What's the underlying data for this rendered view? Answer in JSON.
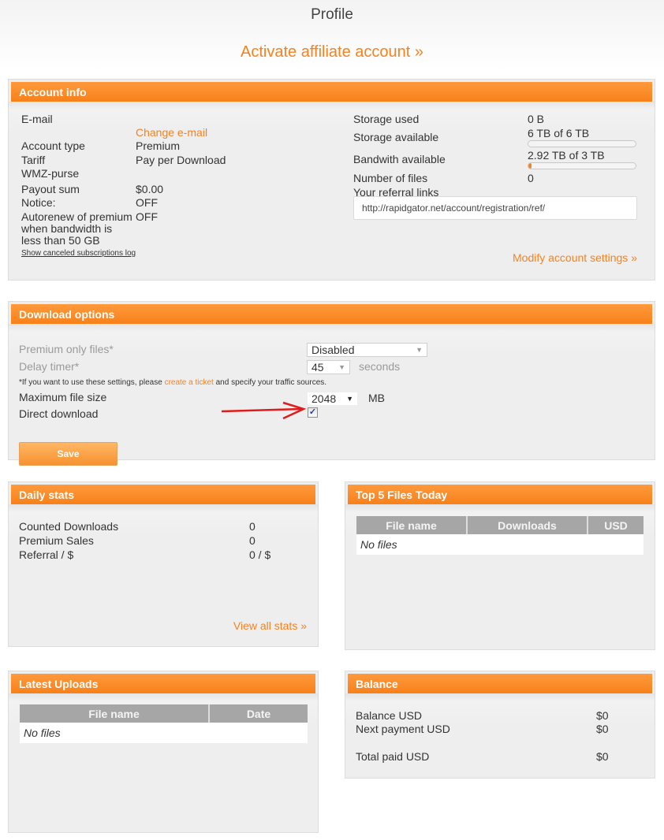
{
  "page": {
    "title": "Profile",
    "affiliate_link": "Activate affiliate account »"
  },
  "account_info": {
    "header": "Account info",
    "left": {
      "email_label": "E-mail",
      "change_email_link": "Change e-mail",
      "account_type_label": "Account type",
      "account_type_value": "Premium",
      "tariff_label": "Tariff",
      "tariff_value": "Pay per Download",
      "wmz_label": "WMZ-purse",
      "payout_label": "Payout sum",
      "payout_value": "$0.00",
      "notice_label": "Notice:",
      "notice_value": "OFF",
      "autorenew_label_1": "Autorenew of premium",
      "autorenew_label_2": "when bandwidth is",
      "autorenew_label_3": "less than 50 GB",
      "autorenew_value": "OFF",
      "canceled_log_link": "Show canceled subscriptions log"
    },
    "right": {
      "storage_used_label": "Storage used",
      "storage_used_value": "0 B",
      "storage_available_label": "Storage available",
      "storage_available_value": "6 TB of 6 TB",
      "storage_used_fraction": 0.0,
      "bandwidth_label": "Bandwith available",
      "bandwidth_value": "2.92 TB of 3 TB",
      "bandwidth_used_fraction": 0.027,
      "files_label": "Number of files",
      "files_value": "0",
      "referral_label": "Your referral links",
      "referral_url": "http://rapidgator.net/account/registration/ref/",
      "modify_link": "Modify account settings »"
    }
  },
  "download_options": {
    "header": "Download options",
    "premium_only_label": "Premium only files*",
    "premium_only_value": "Disabled",
    "delay_label": "Delay timer*",
    "delay_value": "45",
    "delay_unit": "seconds",
    "note_prefix": "*If you want to use these settings, please ",
    "note_link": "create a ticket",
    "note_suffix": " and specify your traffic sources.",
    "max_size_label": "Maximum file size",
    "max_size_value": "2048",
    "max_size_unit": "MB",
    "direct_download_label": "Direct download",
    "direct_download_checked": true,
    "save_label": "Save",
    "annotation_arrow_color": "#e01b1b"
  },
  "daily_stats": {
    "header": "Daily stats",
    "rows": [
      {
        "label": "Counted Downloads",
        "value": "0"
      },
      {
        "label": "Premium Sales",
        "value": "0"
      },
      {
        "label": "Referral / $",
        "value": "0 / $"
      }
    ],
    "view_all_link": "View all stats »"
  },
  "top_files": {
    "header": "Top 5 Files Today",
    "columns": [
      "File name",
      "Downloads",
      "USD"
    ],
    "empty_text": "No files"
  },
  "latest_uploads": {
    "header": "Latest Uploads",
    "columns": [
      "File name",
      "Date"
    ],
    "empty_text": "No files"
  },
  "balance": {
    "header": "Balance",
    "rows": [
      {
        "label": "Balance USD",
        "value": "$0"
      },
      {
        "label": "Next payment USD",
        "value": "$0"
      },
      {
        "label": "Total paid USD",
        "value": "$0"
      }
    ]
  },
  "colors": {
    "accent": "#f5821f",
    "header_gradient_top": "#ff9a3c",
    "header_gradient_bottom": "#f7811a",
    "panel_bg": "#eeeeee",
    "table_header": "#a6a6a6"
  }
}
